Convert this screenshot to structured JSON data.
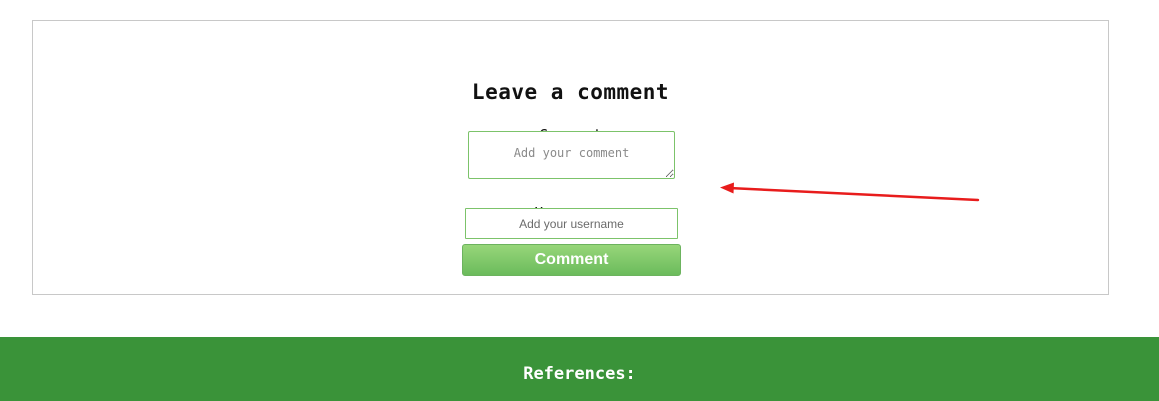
{
  "comment_form": {
    "title": "Leave a comment",
    "comment_label": "Comment",
    "comment_placeholder": "Add your comment",
    "username_label": "Username",
    "username_placeholder": "Add your username",
    "submit_label": "Comment"
  },
  "footer": {
    "title": "References:"
  },
  "colors": {
    "footer_background": "#3a9339",
    "button_gradient_top": "#97d67a",
    "button_gradient_bottom": "#6bbb5c",
    "field_border": "#7cc36a",
    "annotation_arrow": "#e81c1c"
  }
}
